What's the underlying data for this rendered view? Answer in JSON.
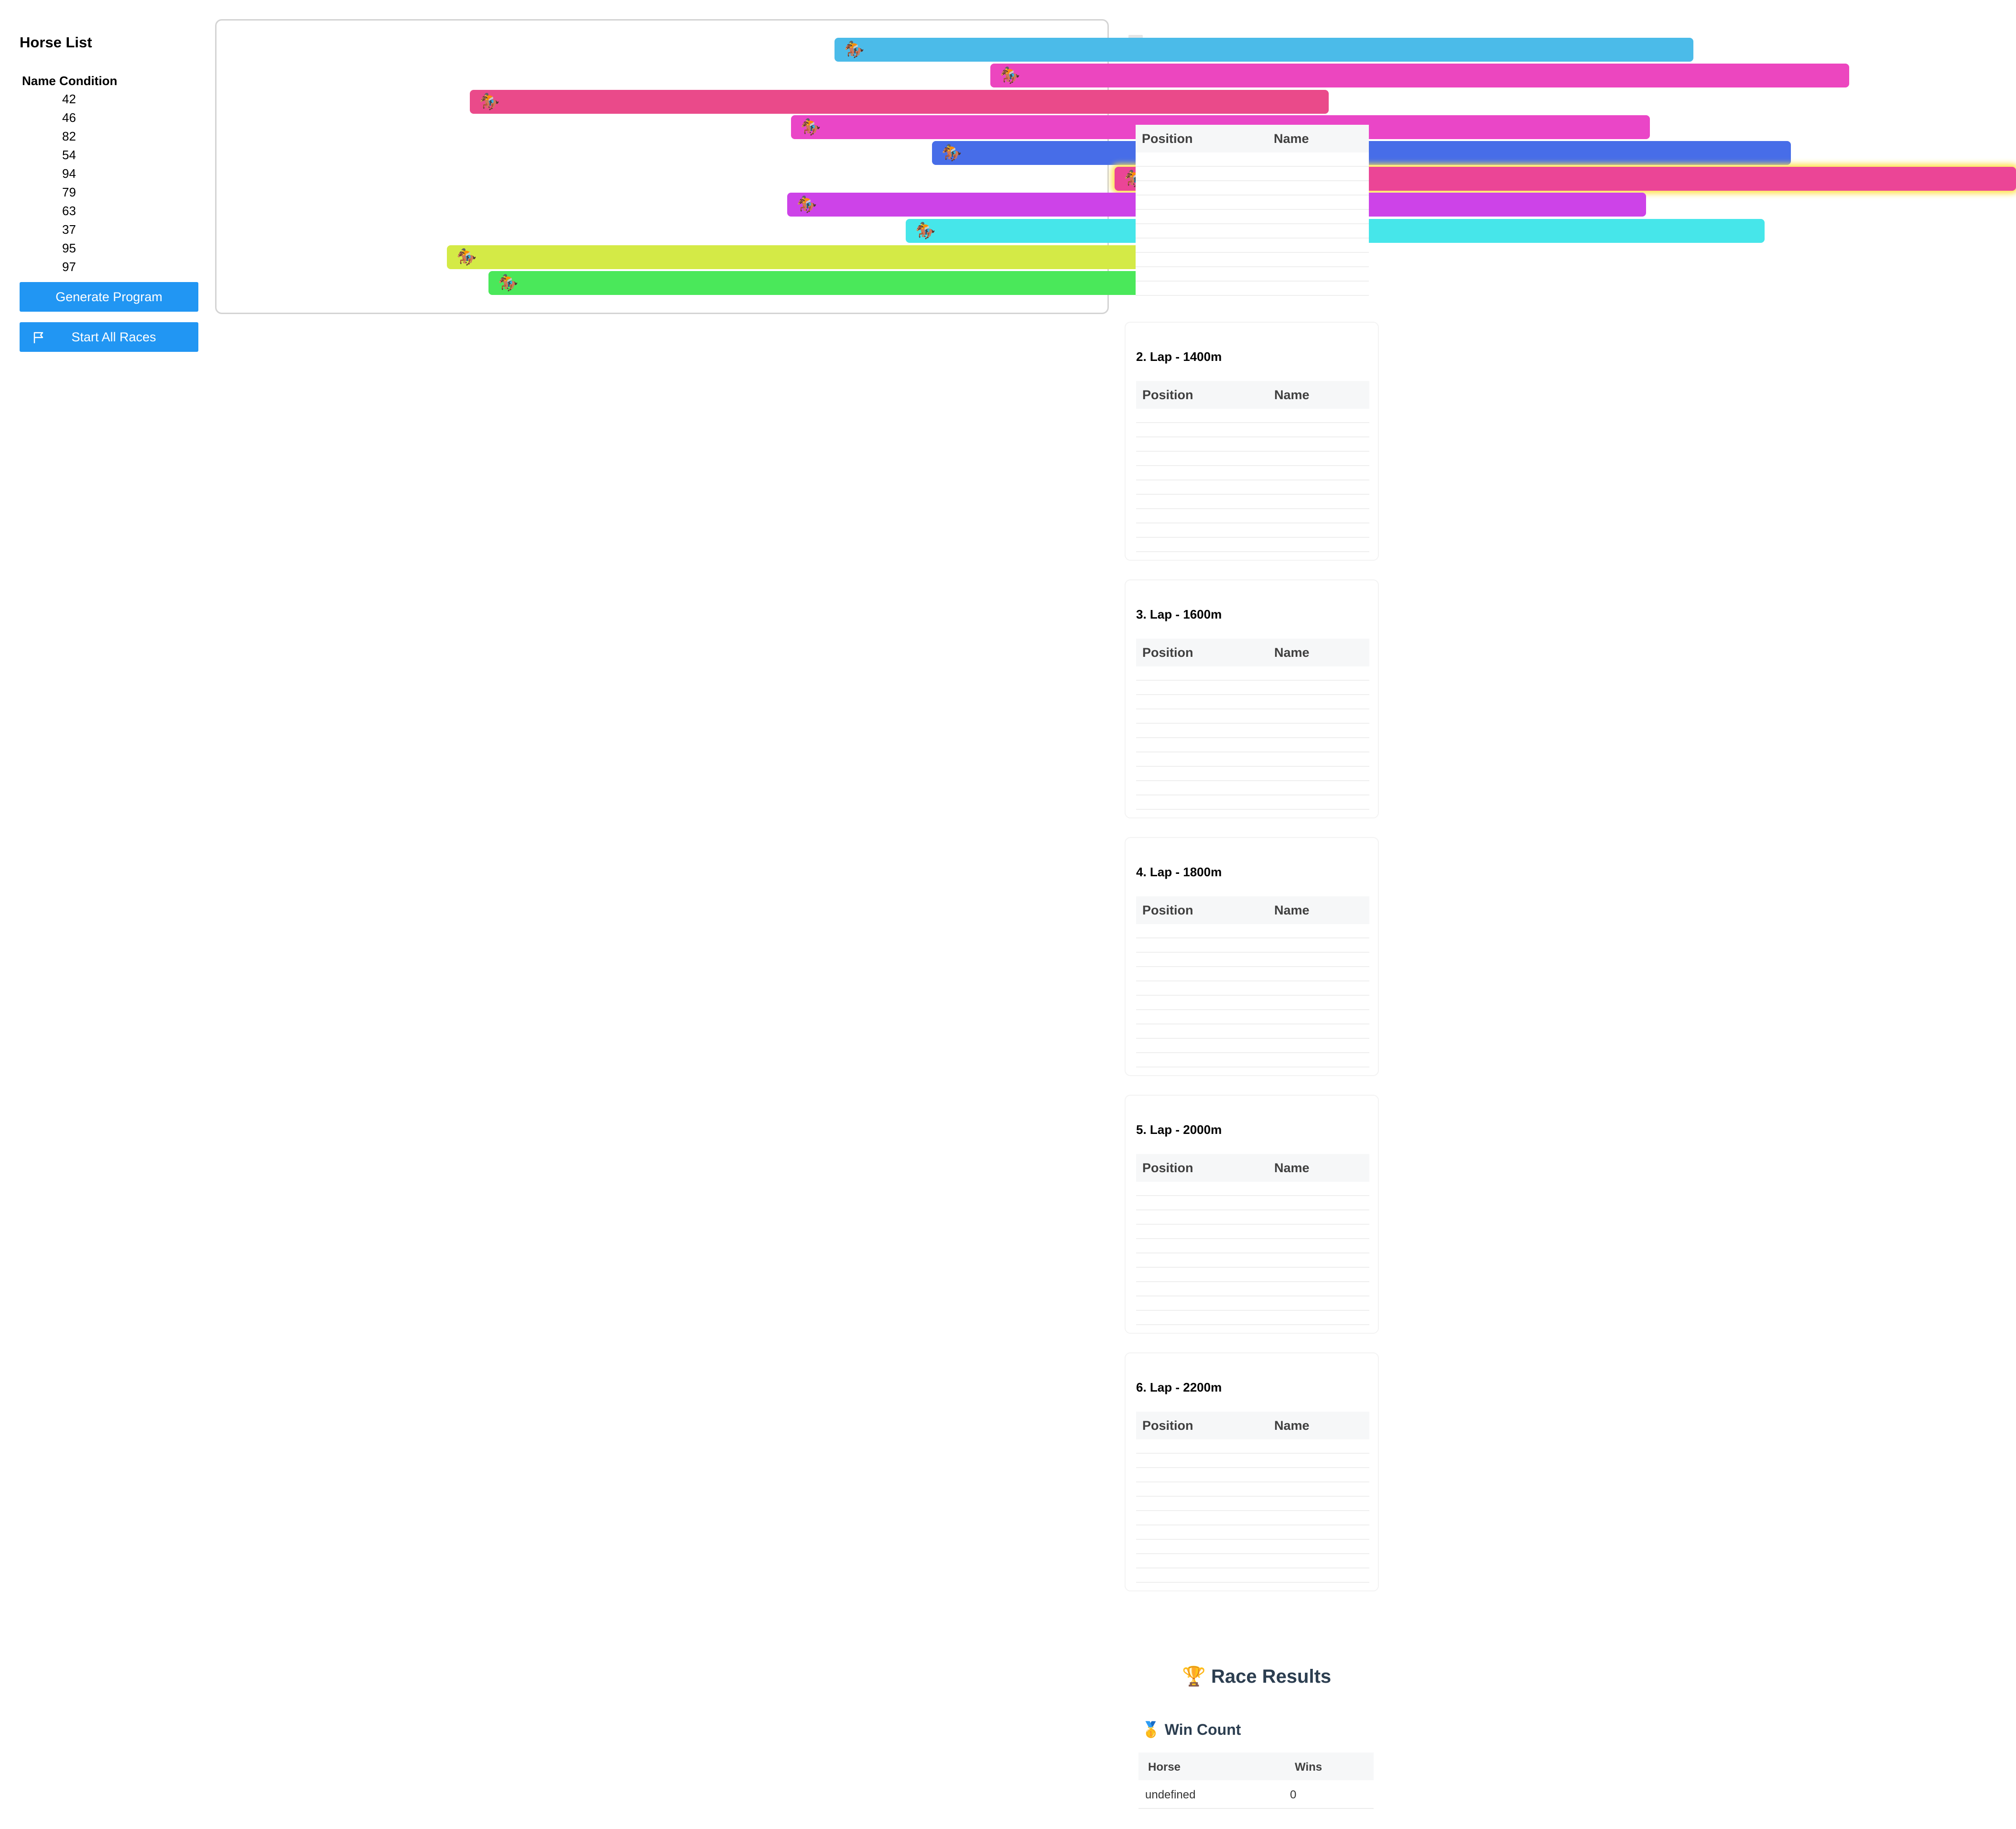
{
  "sidebar": {
    "title": "Horse List",
    "table_header": "Name Condition",
    "conditions": [
      "42",
      "46",
      "82",
      "54",
      "94",
      "79",
      "63",
      "37",
      "95",
      "97"
    ],
    "generate_label": "Generate Program",
    "start_label": "Start All Races"
  },
  "track": {
    "horse_icon": "🏇",
    "lanes": [
      {
        "color": "#4bbbe9"
      },
      {
        "color": "#ec46bf"
      },
      {
        "color": "#ea4a8a"
      },
      {
        "color": "#ea46c7"
      },
      {
        "color": "#476de8"
      },
      {
        "color": "#eb4596",
        "leader": true
      },
      {
        "color": "#cd43e8"
      },
      {
        "color": "#46e6ea"
      },
      {
        "color": "#d4ea46"
      },
      {
        "color": "#4ae85a"
      }
    ]
  },
  "program": {
    "position_header": "Position",
    "name_header": "Name",
    "laps": [
      {
        "title": "2. Lap - 1400m"
      },
      {
        "title": "3. Lap - 1600m"
      },
      {
        "title": "4. Lap - 1800m"
      },
      {
        "title": "5. Lap - 2000m"
      },
      {
        "title": "6. Lap - 2200m"
      }
    ]
  },
  "results": {
    "title": "Race Results",
    "trophy_icon": "🏆",
    "win_count_title": "Win Count",
    "medal_icon": "🥇",
    "horse_header": "Horse",
    "wins_header": "Wins",
    "rows": [
      {
        "horse": "undefined",
        "wins": "0"
      }
    ]
  }
}
